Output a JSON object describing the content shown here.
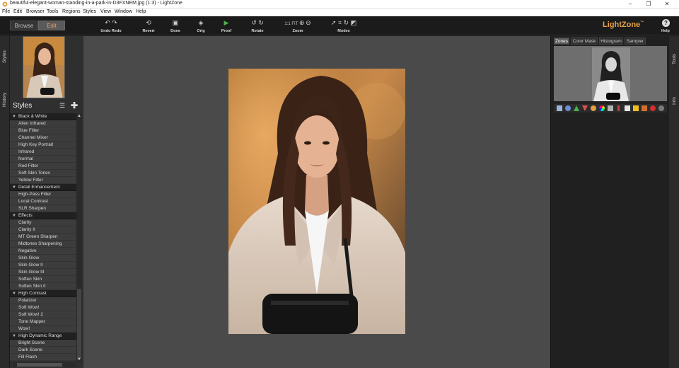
{
  "window": {
    "title": "beautiful-elegant-woman-standing-in-a-park-in-D3FXNEM.jpg (1:3) - LightZone",
    "controls": [
      "–",
      "❐",
      "✕"
    ]
  },
  "menu": [
    "File",
    "Edit",
    "Browser",
    "Tools",
    "Regions",
    "Styles",
    "View",
    "Window",
    "Help"
  ],
  "mode_switch": {
    "browse": "Browse",
    "edit": "Edit"
  },
  "toolbar": {
    "undo_redo": "Undo Redo",
    "revert": "Revert",
    "done": "Done",
    "orig": "Orig",
    "proof": "Proof",
    "rotate": "Rotate",
    "zoom": "Zoom",
    "zoom_one": "1:1",
    "zoom_fit": "FIT",
    "modes": "Modes"
  },
  "brand": {
    "name": "LightZone",
    "tm": "™"
  },
  "help": {
    "label": "Help",
    "icon": "?"
  },
  "left_tabs": {
    "styles": "Styles",
    "history": "History"
  },
  "right_tabs": {
    "tools": "Tools",
    "info": "Info"
  },
  "styles_panel": {
    "title": "Styles",
    "categories": [
      {
        "name": "Black & White",
        "items": [
          "Alien Infrared",
          "Blue Filter",
          "Channel Mixer",
          "High Key Portrait",
          "Infrared",
          "Normal",
          "Red Filter",
          "Soft Skin Tones",
          "Yellow Filter"
        ]
      },
      {
        "name": "Detail Enhancement",
        "items": [
          "High-Pass Filter",
          "Local Contrast",
          "SLR Sharpen"
        ]
      },
      {
        "name": "Effects",
        "items": [
          "Clarity",
          "Clarity II",
          "MT Green Sharpen",
          "Midtones Sharpening",
          "Negative",
          "Skin Glow",
          "Skin Glow II",
          "Skin Glow III",
          "Soften Skin",
          "Soften Skin II"
        ]
      },
      {
        "name": "High Contrast",
        "items": [
          "Polarizer",
          "Soft Wow!",
          "Soft Wow! 2",
          "Tone Mapper",
          "Wow!"
        ]
      },
      {
        "name": "High Dynamic Range",
        "items": [
          "Bright Scene",
          "Dark Scene",
          "Fill Flash"
        ]
      }
    ]
  },
  "right_panel_tabs": [
    "Zones",
    "Color Mask",
    "Histogram",
    "Sampler"
  ],
  "colors": {
    "accent": "#e8a24a",
    "canvas": "#4a4a4a"
  }
}
